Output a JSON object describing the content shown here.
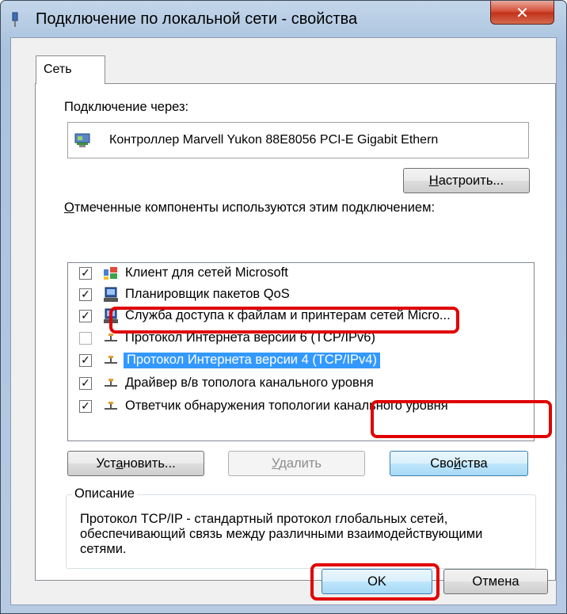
{
  "window": {
    "title": "Подключение по локальной сети - свойства",
    "close_symbol": "✕"
  },
  "tabs": [
    {
      "label": "Сеть",
      "active": true
    }
  ],
  "connect_via": {
    "label": "Подключение через:",
    "device": "Контроллер Marvell Yukon 88E8056 PCI-E Gigabit Ethern",
    "device_icon": "network-adapter-icon"
  },
  "configure_button": {
    "pre": "",
    "accel": "Н",
    "post": "астроить..."
  },
  "components_label": {
    "accel": "О",
    "rest": "тмеченные компоненты используются этим подключением:"
  },
  "components": [
    {
      "label": "Клиент для сетей Microsoft",
      "checked": true,
      "icon": "network-client-icon"
    },
    {
      "label": "Планировщик пакетов QoS",
      "checked": true,
      "icon": "network-service-icon"
    },
    {
      "label": "Служба доступа к файлам и принтерам сетей Micro...",
      "checked": true,
      "icon": "network-service-icon"
    },
    {
      "label": "Протокол Интернета версии 6 (TCP/IPv6)",
      "checked": false,
      "icon": "protocol-icon"
    },
    {
      "label": "Протокол Интернета версии 4 (TCP/IPv4)",
      "checked": true,
      "icon": "protocol-icon",
      "selected": true
    },
    {
      "label": "Драйвер в/в тополога канального уровня",
      "checked": true,
      "icon": "protocol-icon"
    },
    {
      "label": "Ответчик обнаружения топологии канального уровня",
      "checked": true,
      "icon": "protocol-icon"
    }
  ],
  "buttons": {
    "install": {
      "pre": "Уст",
      "accel": "а",
      "post": "новить..."
    },
    "uninstall": {
      "pre": "",
      "accel": "У",
      "post": "далить",
      "disabled": true
    },
    "properties": {
      "pre": "Сво",
      "accel": "й",
      "post": "ства"
    },
    "ok": "OK",
    "cancel": "Отмена"
  },
  "description": {
    "title": "Описание",
    "text": "Протокол TCP/IP - стандартный протокол глобальных сетей, обеспечивающий связь между различными взаимодействующими сетями."
  },
  "highlight_color": "#e00000",
  "selection_color": "#3399ff"
}
